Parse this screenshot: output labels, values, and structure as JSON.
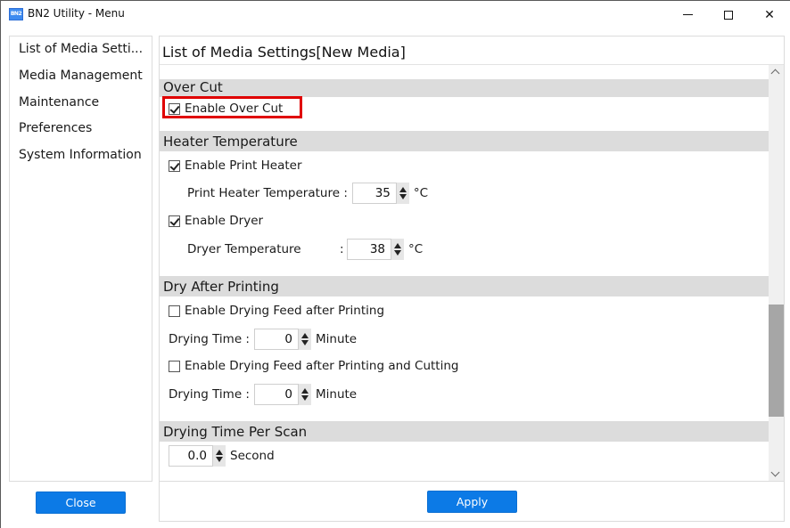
{
  "window": {
    "title": "BN2 Utility - Menu",
    "app_icon_text": "BN2",
    "controls": {
      "minimize": "minimize",
      "maximize": "maximize",
      "close": "✕"
    }
  },
  "sidebar": {
    "items": [
      {
        "label": "List of Media Setti..."
      },
      {
        "label": "Media Management"
      },
      {
        "label": "Maintenance"
      },
      {
        "label": "Preferences"
      },
      {
        "label": "System Information"
      }
    ],
    "close_label": "Close"
  },
  "main": {
    "title": "List of Media Settings[New Media]",
    "apply_label": "Apply",
    "scroll_position": 0.58,
    "sections": {
      "over_cut": {
        "header": "Over Cut",
        "enable_label": "Enable Over Cut",
        "enable_checked": true
      },
      "heater_temperature": {
        "header": "Heater Temperature",
        "print_heater_label": "Enable Print Heater",
        "print_heater_checked": true,
        "print_heater_temp_label": "Print Heater Temperature :",
        "print_heater_temp_value": "35",
        "print_heater_temp_unit": "°C",
        "dryer_label": "Enable Dryer",
        "dryer_checked": true,
        "dryer_temp_label": "Dryer Temperature",
        "dryer_temp_colon": ":",
        "dryer_temp_value": "38",
        "dryer_temp_unit": "°C"
      },
      "dry_after_printing": {
        "header": "Dry After Printing",
        "feed_after_printing_label": "Enable Drying Feed after Printing",
        "feed_after_printing_checked": false,
        "drying_time_1_label": "Drying Time :",
        "drying_time_1_value": "0",
        "drying_time_1_unit": "Minute",
        "feed_after_cutting_label": "Enable Drying Feed after Printing and Cutting",
        "feed_after_cutting_checked": false,
        "drying_time_2_label": "Drying Time :",
        "drying_time_2_value": "0",
        "drying_time_2_unit": "Minute"
      },
      "drying_time_per_scan": {
        "header": "Drying Time Per Scan",
        "value": "0.0",
        "unit": "Second"
      }
    }
  },
  "colors": {
    "accent_button": "#0c7ae6",
    "highlight_border": "#e00000",
    "section_header_bg": "#dcdcdc"
  }
}
